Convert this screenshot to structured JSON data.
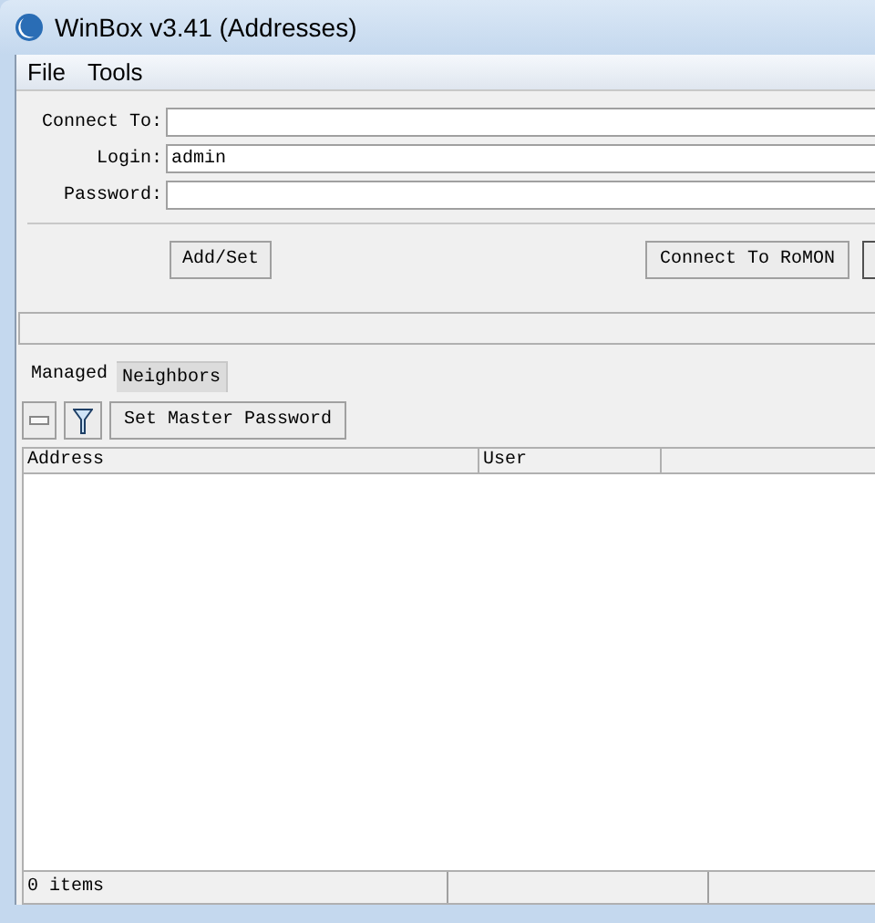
{
  "window": {
    "title": "WinBox v3.41 (Addresses)"
  },
  "menu": [
    "File",
    "Tools"
  ],
  "form": [
    {
      "label": "Connect To:"
    },
    {
      "label": "Login:",
      "value": "admin"
    },
    {
      "label": "Password:"
    }
  ],
  "buttons": {
    "add": "Add/Set",
    "romon": "Connect To RoMON"
  },
  "tabs": [
    {
      "label": "Managed",
      "selected": true
    },
    {
      "label": "Neighbors",
      "selected": false
    }
  ],
  "toolbar": {
    "set_master_password": "Set Master Password"
  },
  "table": {
    "columns": [
      "Address",
      "User"
    ]
  },
  "status_bar": [
    "0 items"
  ]
}
